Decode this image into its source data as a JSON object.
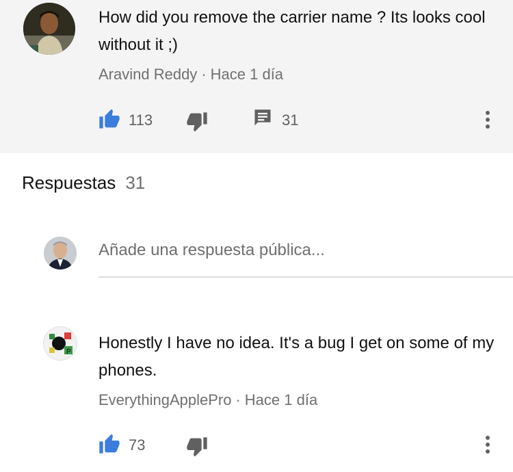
{
  "parent": {
    "text": "How did you remove the carrier name ? Its looks cool without it ;)",
    "author": "Aravind Reddy",
    "separator": "·",
    "time": "Hace 1 día",
    "likes": "113",
    "replies": "31"
  },
  "replies_header": {
    "title": "Respuestas",
    "count": "31"
  },
  "reply_input": {
    "placeholder": "Añade una respuesta pública..."
  },
  "reply": {
    "text": "Honestly I have no idea. It's a bug I get on some of my phones.",
    "author": "EverythingApplePro",
    "separator": "·",
    "time": "Hace 1 día",
    "likes": "73"
  },
  "colors": {
    "like_blue": "#3b7ddd",
    "icon_gray": "#606060",
    "parent_bg": "#f4f4f4"
  },
  "icons": [
    "thumb-up-icon",
    "thumb-down-icon",
    "comment-icon",
    "more-vert-icon"
  ]
}
